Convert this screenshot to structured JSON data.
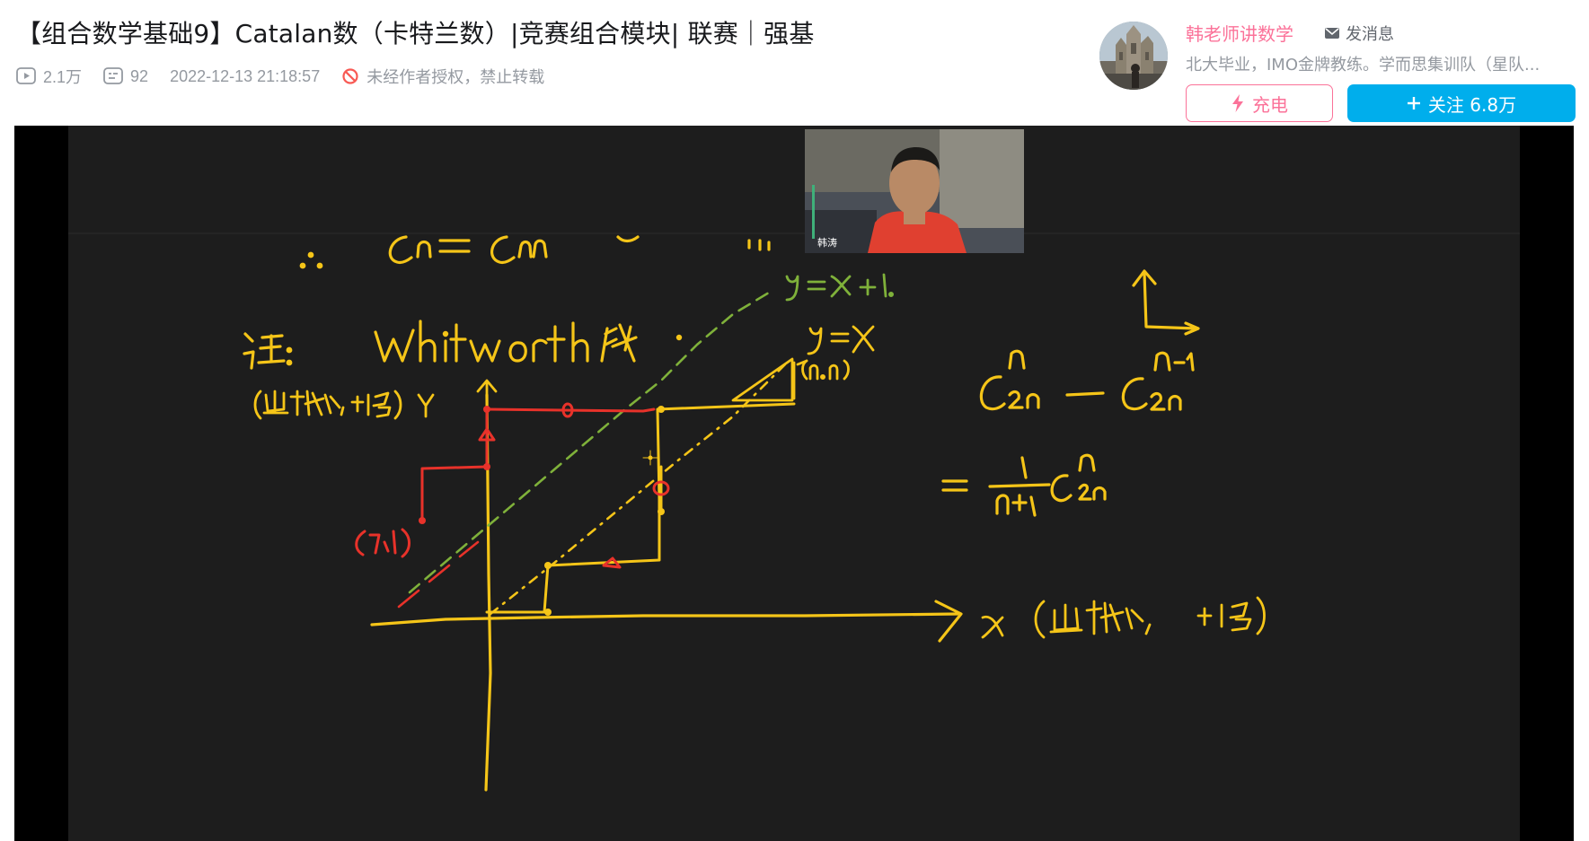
{
  "video": {
    "title": "【组合数学基础9】Catalan数（卡特兰数）|竞赛组合模块| 联赛｜强基",
    "views": "2.1万",
    "danmaku": "92",
    "date": "2022-12-13 21:18:57",
    "notice": "未经作者授权，禁止转载"
  },
  "uploader": {
    "name": "韩老师讲数学",
    "message_label": "发消息",
    "description": "北大毕业，IMO金牌教练。学而思集训队（星队...",
    "charge_label": "充电",
    "follow_label": "关注 6.8万"
  },
  "player": {
    "webcam_name": "韩涛"
  },
  "colors": {
    "accent_pink": "#fb7299",
    "accent_blue": "#00aeec",
    "ink_yellow": "#f5c518",
    "ink_red": "#e8322a",
    "ink_green": "#7fb13a"
  }
}
